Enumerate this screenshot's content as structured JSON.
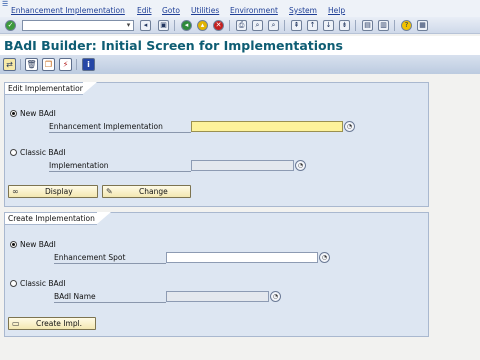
{
  "menubar": {
    "items": [
      "Enhancement Implementation",
      "Edit",
      "Goto",
      "Utilities",
      "Environment",
      "System",
      "Help"
    ]
  },
  "toolbar": {
    "command_field_value": "",
    "icons": [
      "enter-icon",
      "save-icon",
      "back-icon",
      "exit-icon",
      "cancel-icon",
      "print-icon",
      "find-icon",
      "find-next-icon",
      "first-page-icon",
      "previous-page-icon",
      "next-page-icon",
      "last-page-icon",
      "new-session-icon",
      "shortcut-icon",
      "help-icon",
      "customize-layout-icon"
    ]
  },
  "title": {
    "text": "BAdI Builder: Initial Screen for Implementations"
  },
  "app_toolbar": {
    "icons": [
      "other-object-icon",
      "delete-icon",
      "copy-icon",
      "activate-icon",
      "info-icon"
    ]
  },
  "edit_panel": {
    "heading": "Edit Implementation",
    "new_badi": {
      "label": "New BAdI",
      "selected": true,
      "field_label": "Enhancement Implementation",
      "field_value": ""
    },
    "classic_badi": {
      "label": "Classic BAdI",
      "selected": false,
      "field_label": "Implementation",
      "field_value": ""
    },
    "buttons": {
      "display": "Display",
      "change": "Change"
    }
  },
  "create_panel": {
    "heading": "Create Implementation",
    "new_badi": {
      "label": "New BAdI",
      "selected": true,
      "field_label": "Enhancement Spot",
      "field_value": ""
    },
    "classic_badi": {
      "label": "Classic BAdI",
      "selected": false,
      "field_label": "BAdI Name",
      "field_value": ""
    },
    "buttons": {
      "create": "Create Impl."
    }
  },
  "colors": {
    "title": "#0e5d73",
    "panel_bg": "#dde6f2",
    "required_field": "#fdf29b",
    "button_bg": "#f3e7b2",
    "menu_text": "#1f3f96"
  }
}
